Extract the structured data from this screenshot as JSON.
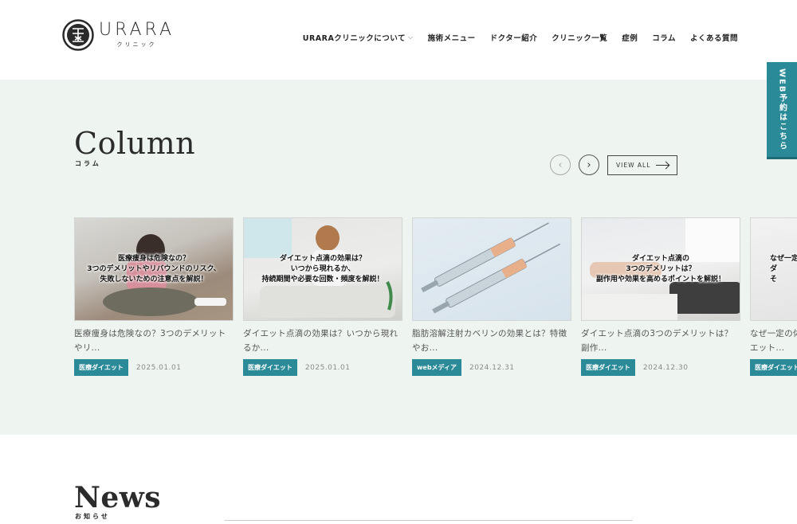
{
  "header": {
    "logo_text": "URARA",
    "logo_sub": "クリニック",
    "nav": [
      {
        "label": "URARAクリニックについて",
        "has_dropdown": true
      },
      {
        "label": "施術メニュー"
      },
      {
        "label": "ドクター紹介"
      },
      {
        "label": "クリニック一覧"
      },
      {
        "label": "症例"
      },
      {
        "label": "コラム"
      },
      {
        "label": "よくある質問"
      }
    ]
  },
  "side_tab": {
    "label": "WEB予約はこちら"
  },
  "column": {
    "title": "Column",
    "subtitle": "コラム",
    "view_all": "VIEW ALL",
    "cards": [
      {
        "overlay": "医療痩身は危険なの？\n3つのデメリットやリバウンドのリスク、\n失敗しないための注意点を解説！",
        "title": "医療痩身は危険なの？3つのデメリットやリ...",
        "tag": "医療ダイエット",
        "date": "2025.01.01"
      },
      {
        "overlay": "ダイエット点滴の効果は？\nいつから現れるか、\n持続期間や必要な回数・頻度を解説！",
        "title": "ダイエット点滴の効果は？いつから現れるか...",
        "tag": "医療ダイエット",
        "date": "2025.01.01"
      },
      {
        "overlay": "",
        "title": "脂肪溶解注射カベリンの効果とは？特徴やお...",
        "tag": "webメディア",
        "date": "2024.12.31"
      },
      {
        "overlay": "ダイエット点滴の\n3つのデメリットは？\n副作用や効果を高めるポイントを解説！",
        "title": "ダイエット点滴の3つのデメリットは？副作...",
        "tag": "医療ダイエット",
        "date": "2024.12.30"
      },
      {
        "overlay": "なぜ一定の\nダ\nそ",
        "title": "なぜ一定の体\nエット...",
        "tag": "医療ダイエット",
        "date": ""
      }
    ]
  },
  "news": {
    "title": "News",
    "subtitle": "お知らせ"
  }
}
